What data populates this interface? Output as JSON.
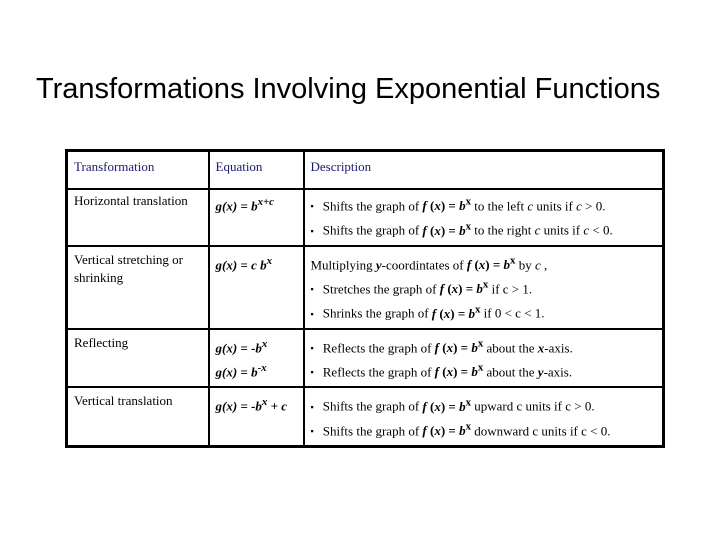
{
  "slide": {
    "title": "Transformations Involving Exponential Functions"
  },
  "table": {
    "headers": [
      "Transformation",
      "Equation",
      "Description"
    ],
    "bullet": "▪",
    "rows": [
      {
        "transformation": "Horizontal translation",
        "equations": [
          "g(x) = b^(x+c)"
        ],
        "equations_display": [
          "g(x) = bx+c"
        ],
        "intro": "",
        "bullets": [
          "Shifts the graph of f (x) = bx to the left c units if c > 0.",
          "Shifts the graph of f (x) = bx to the right c units if c < 0."
        ]
      },
      {
        "transformation": "Vertical stretching or shrinking",
        "equations": [
          "g(x) = c b^x"
        ],
        "equations_display": [
          "g(x) = c bx"
        ],
        "intro": "Multiplying y-coordintates of f (x) = bx by c ,",
        "bullets": [
          "Stretches the graph of f (x) = bx if c > 1.",
          "Shrinks the graph of f (x) = bx if 0 < c < 1."
        ]
      },
      {
        "transformation": "Reflecting",
        "equations": [
          "g(x) = -b^x",
          "g(x) = b^-x"
        ],
        "equations_display": [
          "g(x) = -bx",
          "g(x) = b-x"
        ],
        "intro": "",
        "bullets": [
          "Reflects the graph of f (x) = bx about the x-axis.",
          "Reflects the graph of f (x) = bx about the y-axis."
        ]
      },
      {
        "transformation": "Vertical translation",
        "equations": [
          "g(x) = -b^x + c"
        ],
        "equations_display": [
          "g(x) = -bx + c"
        ],
        "intro": "",
        "bullets": [
          "Shifts the graph of f (x) = bx upward c units if c > 0.",
          "Shifts the graph of f (x) = bx downward c units if c < 0."
        ]
      }
    ]
  },
  "colors": {
    "header_text": "#1a1a6e",
    "body_text": "#000000",
    "border": "#000000"
  }
}
